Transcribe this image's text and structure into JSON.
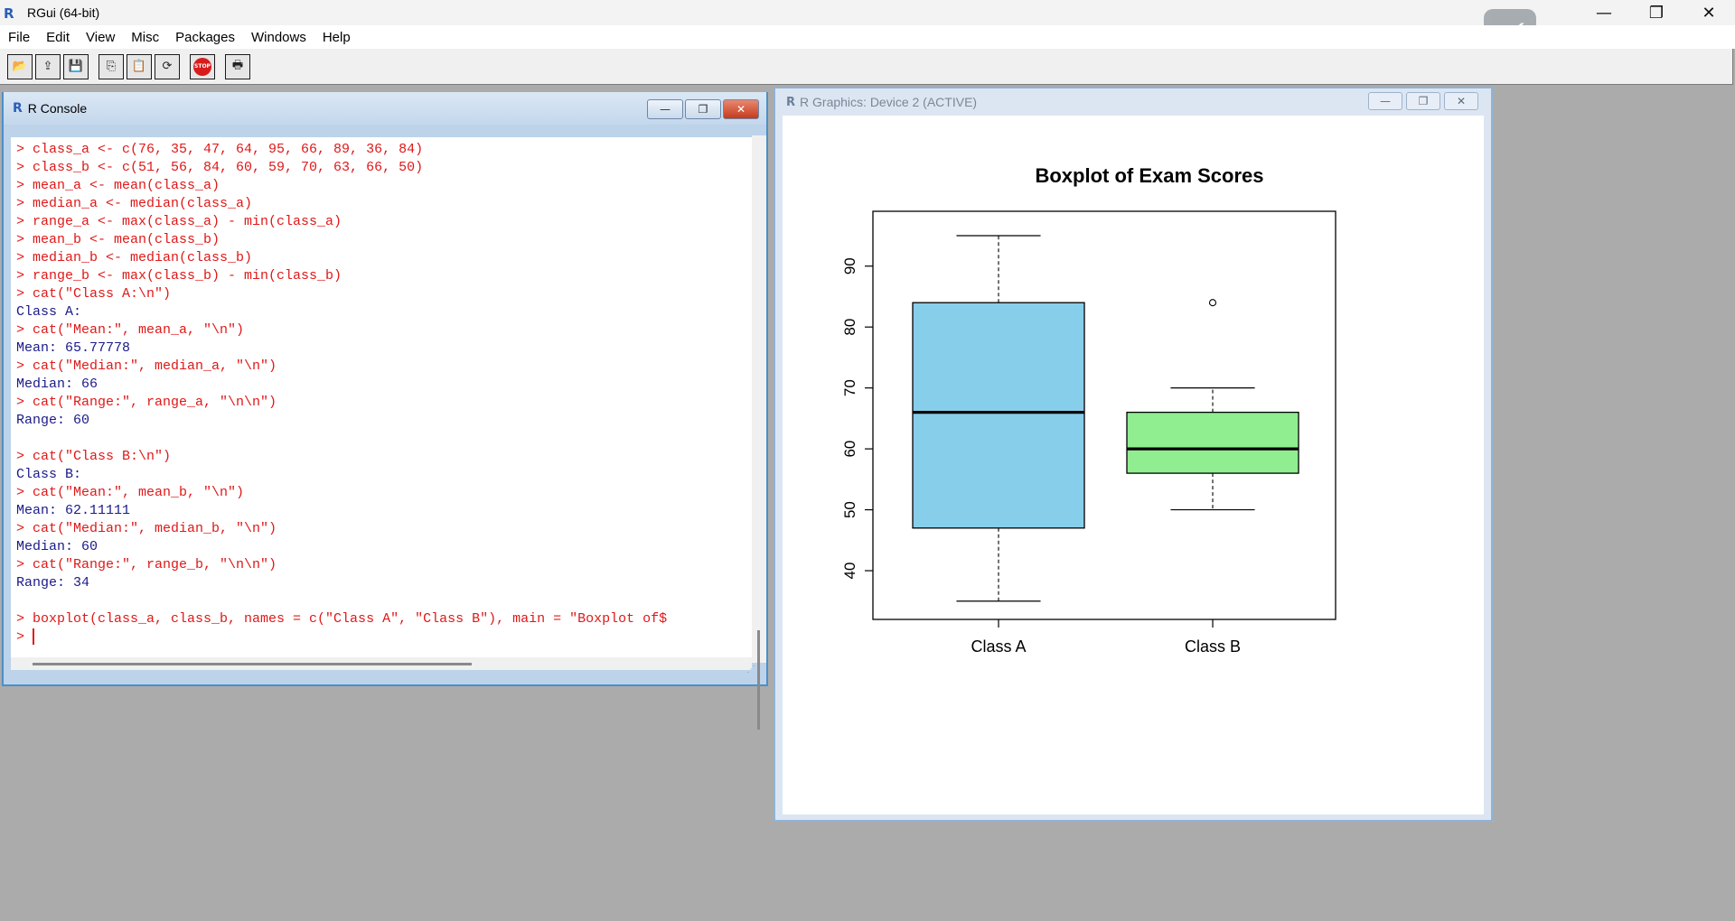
{
  "app": {
    "title": "RGui (64-bit)",
    "logo": "R"
  },
  "window_controls": {
    "minimize": "—",
    "restore": "❐",
    "close": "✕"
  },
  "menu": [
    "File",
    "Edit",
    "View",
    "Misc",
    "Packages",
    "Windows",
    "Help"
  ],
  "toolbar": {
    "buttons": [
      {
        "name": "open-script-icon",
        "glyph": "📂"
      },
      {
        "name": "load-workspace-icon",
        "glyph": "⇪"
      },
      {
        "name": "save-icon",
        "glyph": "💾"
      },
      {
        "name": "copy-icon",
        "glyph": "⎘"
      },
      {
        "name": "paste-icon",
        "glyph": "📋"
      },
      {
        "name": "copy-paste-icon",
        "glyph": "⟳"
      },
      {
        "name": "stop-icon",
        "glyph": "STOP"
      },
      {
        "name": "print-icon",
        "glyph": "🖶"
      }
    ]
  },
  "console": {
    "title": "R Console",
    "lines": [
      {
        "type": "cmd",
        "text": "> class_a <- c(76, 35, 47, 64, 95, 66, 89, 36, 84)"
      },
      {
        "type": "cmd",
        "text": "> class_b <- c(51, 56, 84, 60, 59, 70, 63, 66, 50)"
      },
      {
        "type": "cmd",
        "text": "> mean_a <- mean(class_a)"
      },
      {
        "type": "cmd",
        "text": "> median_a <- median(class_a)"
      },
      {
        "type": "cmd",
        "text": "> range_a <- max(class_a) - min(class_a)"
      },
      {
        "type": "cmd",
        "text": "> mean_b <- mean(class_b)"
      },
      {
        "type": "cmd",
        "text": "> median_b <- median(class_b)"
      },
      {
        "type": "cmd",
        "text": "> range_b <- max(class_b) - min(class_b)"
      },
      {
        "type": "cmd",
        "text": "> cat(\"Class A:\\n\")"
      },
      {
        "type": "out",
        "text": "Class A:"
      },
      {
        "type": "cmd",
        "text": "> cat(\"Mean:\", mean_a, \"\\n\")"
      },
      {
        "type": "out",
        "text": "Mean: 65.77778"
      },
      {
        "type": "cmd",
        "text": "> cat(\"Median:\", median_a, \"\\n\")"
      },
      {
        "type": "out",
        "text": "Median: 66"
      },
      {
        "type": "cmd",
        "text": "> cat(\"Range:\", range_a, \"\\n\\n\")"
      },
      {
        "type": "out",
        "text": "Range: 60"
      },
      {
        "type": "blank",
        "text": ""
      },
      {
        "type": "cmd",
        "text": "> cat(\"Class B:\\n\")"
      },
      {
        "type": "out",
        "text": "Class B:"
      },
      {
        "type": "cmd",
        "text": "> cat(\"Mean:\", mean_b, \"\\n\")"
      },
      {
        "type": "out",
        "text": "Mean: 62.11111"
      },
      {
        "type": "cmd",
        "text": "> cat(\"Median:\", median_b, \"\\n\")"
      },
      {
        "type": "out",
        "text": "Median: 60"
      },
      {
        "type": "cmd",
        "text": "> cat(\"Range:\", range_b, \"\\n\\n\")"
      },
      {
        "type": "out",
        "text": "Range: 34"
      },
      {
        "type": "blank",
        "text": ""
      },
      {
        "type": "cmd",
        "text": "> boxplot(class_a, class_b, names = c(\"Class A\", \"Class B\"), main = \"Boxplot of$"
      },
      {
        "type": "prompt",
        "text": "> "
      }
    ]
  },
  "graphics": {
    "title": "R Graphics: Device 2 (ACTIVE)"
  },
  "chart_data": {
    "type": "boxplot",
    "title": "Boxplot of Exam Scores",
    "categories": [
      "Class A",
      "Class B"
    ],
    "ylim": [
      32,
      99
    ],
    "yticks": [
      40,
      50,
      60,
      70,
      80,
      90
    ],
    "boxes": [
      {
        "name": "Class A",
        "min": 35,
        "q1": 47,
        "median": 66,
        "q3": 84,
        "max": 95,
        "outliers": [],
        "color": "#87ceeb"
      },
      {
        "name": "Class B",
        "min": 50,
        "q1": 56,
        "median": 60,
        "q3": 66,
        "max": 70,
        "outliers": [
          84
        ],
        "color": "#90ee90"
      }
    ]
  }
}
